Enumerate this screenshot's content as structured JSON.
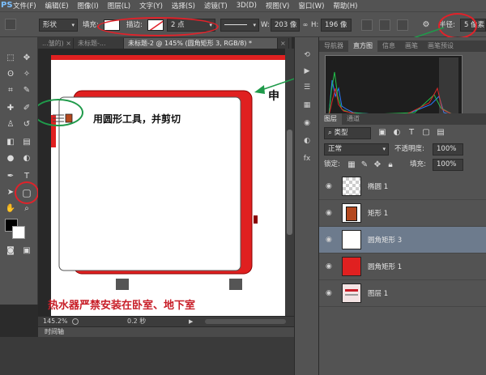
{
  "app": {
    "logo": "PS"
  },
  "menu": [
    "文件(F)",
    "编辑(E)",
    "图像(I)",
    "图层(L)",
    "文字(Y)",
    "选择(S)",
    "滤镜(T)",
    "3D(D)",
    "视图(V)",
    "窗口(W)",
    "帮助(H)"
  ],
  "options": {
    "mode": "形状",
    "fill_label": "填充:",
    "stroke_label": "描边:",
    "stroke_width": "2 点",
    "w_label": "W:",
    "w_value": "203 像",
    "h_label": "H:",
    "h_value": "196 像",
    "radius_label": "半径:",
    "radius_value": "5 像素"
  },
  "tabs": [
    "...皱的) ×",
    "未标题-...",
    "未标题-2 @ 145% (圆角矩形 3, RGB/8) *",
    "×"
  ],
  "canvas": {
    "annotation": "用圆形工具，并剪切",
    "bottom_text": "热水器严禁安装在卧室、地下室",
    "side_text": "申"
  },
  "status": {
    "zoom": "145.2%",
    "time": "0.2 秒"
  },
  "timeline": {
    "label": "时间轴"
  },
  "panels": {
    "top_tabs": [
      "导航器",
      "直方图",
      "信息",
      "画笔",
      "画笔预设"
    ],
    "layer_tabs": [
      "图层",
      "通道"
    ],
    "kind_label": "类型",
    "blend_mode": "正常",
    "opacity_label": "不透明度:",
    "opacity_value": "100%",
    "lock_label": "锁定:",
    "fill_label": "填充:",
    "fill_value": "100%"
  },
  "layers": [
    {
      "name": "椭圆 1",
      "selected": false
    },
    {
      "name": "矩形 1",
      "selected": false
    },
    {
      "name": "圆角矩形 3",
      "selected": true
    },
    {
      "name": "圆角矩形 1",
      "selected": false
    },
    {
      "name": "图层 1",
      "selected": false
    }
  ],
  "colors": {
    "accent_red": "#e0222a",
    "shape_red": "#e02020",
    "callout_green": "#1f9a4a",
    "selected_layer": "#6d7b8d"
  }
}
